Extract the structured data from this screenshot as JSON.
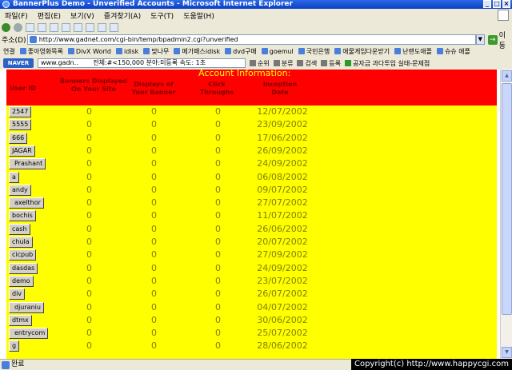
{
  "window": {
    "title": "BannerPlus Demo - Unverified Accounts - Microsoft Internet Explorer"
  },
  "menu": [
    "파일(F)",
    "편집(E)",
    "보기(V)",
    "즐겨찾기(A)",
    "도구(T)",
    "도움말(H)"
  ],
  "address": {
    "label": "주소(D)",
    "url": "http://www.gadnet.com/cgi-bin/temp/bpadmin2.cgi?unverified",
    "go_label": "이동"
  },
  "links": {
    "label": "연결",
    "items": [
      "좋아영화목록",
      "DivX World",
      "idisk",
      "맞나무",
      "메가패스idisk",
      "dvd구매",
      "goemul",
      "국민은행",
      "애물게임다운받기",
      "난랜도애플",
      "슈슈 애플"
    ]
  },
  "naver": {
    "logo": "NAVER",
    "search_value": "www.gadn..",
    "meta": "전체:#<150,000  분야:미등록     속도: 1초",
    "items": [
      "순위",
      "분류",
      "검색",
      "등록"
    ],
    "special": "공자금 과다투입 실태-문제점"
  },
  "table": {
    "section_title": "Account Information:",
    "headers": {
      "user_id": "User ID",
      "banners": "Banners Displayed On Your Site",
      "displays": "Displays of Your Banner",
      "click": "Click Throughs",
      "inception": "Inception Date"
    },
    "rows": [
      {
        "id": "2547",
        "banners": "0",
        "displays": "0",
        "click": "0",
        "date": "12/07/2002"
      },
      {
        "id": "5555",
        "banners": "0",
        "displays": "0",
        "click": "0",
        "date": "23/09/2002"
      },
      {
        "id": "666",
        "banners": "0",
        "displays": "0",
        "click": "0",
        "date": "17/06/2002"
      },
      {
        "id": "JAGAR",
        "banners": "0",
        "displays": "0",
        "click": "0",
        "date": "26/09/2002"
      },
      {
        "id": "Prashant",
        "banners": "0",
        "displays": "0",
        "click": "0",
        "date": "24/09/2002"
      },
      {
        "id": "a",
        "banners": "0",
        "displays": "0",
        "click": "0",
        "date": "06/08/2002"
      },
      {
        "id": "andy",
        "banners": "0",
        "displays": "0",
        "click": "0",
        "date": "09/07/2002"
      },
      {
        "id": "axelthor",
        "banners": "0",
        "displays": "0",
        "click": "0",
        "date": "27/07/2002"
      },
      {
        "id": "bochis",
        "banners": "0",
        "displays": "0",
        "click": "0",
        "date": "11/07/2002"
      },
      {
        "id": "cash",
        "banners": "0",
        "displays": "0",
        "click": "0",
        "date": "26/06/2002"
      },
      {
        "id": "chula",
        "banners": "0",
        "displays": "0",
        "click": "0",
        "date": "20/07/2002"
      },
      {
        "id": "cicpub",
        "banners": "0",
        "displays": "0",
        "click": "0",
        "date": "27/09/2002"
      },
      {
        "id": "dasdas",
        "banners": "0",
        "displays": "0",
        "click": "0",
        "date": "24/09/2002"
      },
      {
        "id": "demo",
        "banners": "0",
        "displays": "0",
        "click": "0",
        "date": "23/07/2002"
      },
      {
        "id": "div",
        "banners": "0",
        "displays": "0",
        "click": "0",
        "date": "26/07/2002"
      },
      {
        "id": "djuraniu",
        "banners": "0",
        "displays": "0",
        "click": "0",
        "date": "04/07/2002"
      },
      {
        "id": "dtmx",
        "banners": "0",
        "displays": "0",
        "click": "0",
        "date": "30/06/2002"
      },
      {
        "id": "entrycom",
        "banners": "0",
        "displays": "0",
        "click": "0",
        "date": "25/07/2002"
      },
      {
        "id": "g",
        "banners": "0",
        "displays": "0",
        "click": "0",
        "date": "28/06/2002"
      }
    ]
  },
  "status": {
    "text": "완료"
  },
  "copyright": "Copyright(c) http://www.happycgi.com"
}
